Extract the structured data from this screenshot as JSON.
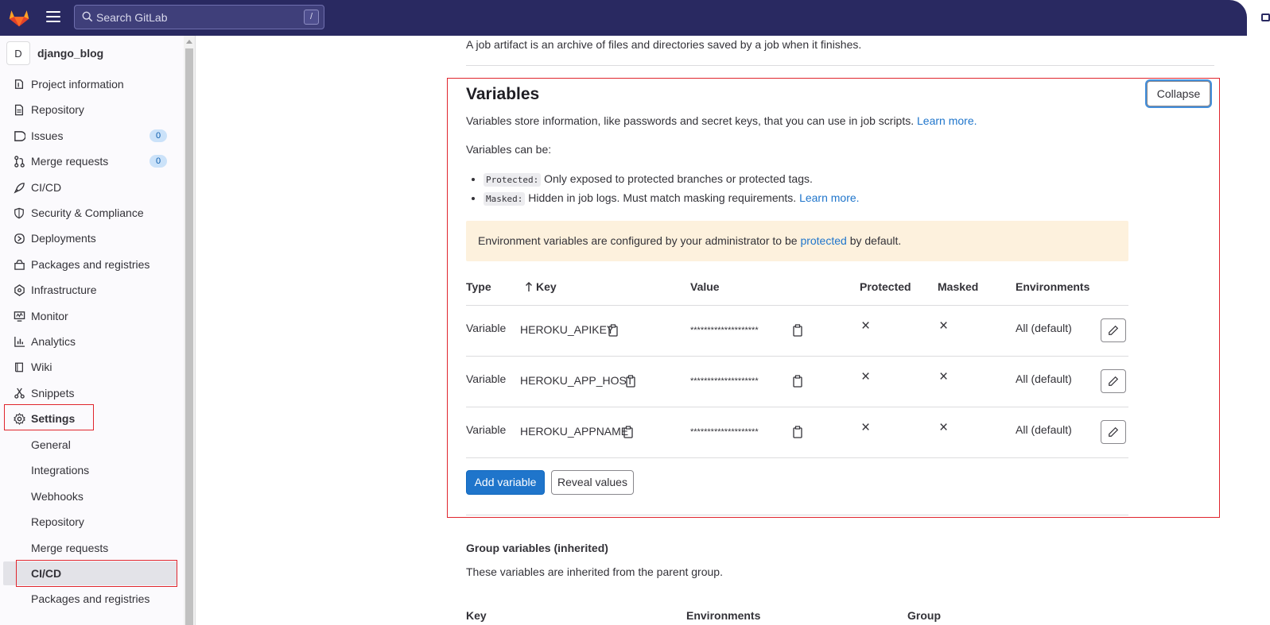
{
  "topbar": {
    "search_placeholder": "Search GitLab",
    "search_shortcut": "/",
    "colors": {
      "bg": "#292961",
      "logo": "#e24329"
    }
  },
  "sidebar": {
    "project_avatar": "D",
    "project_name": "django_blog",
    "items": [
      {
        "label": "Project information",
        "icon": "info-circle-icon"
      },
      {
        "label": "Repository",
        "icon": "document-icon"
      },
      {
        "label": "Issues",
        "icon": "issues-icon",
        "badge": "0"
      },
      {
        "label": "Merge requests",
        "icon": "merge-request-icon",
        "badge": "0"
      },
      {
        "label": "CI/CD",
        "icon": "rocket-icon"
      },
      {
        "label": "Security & Compliance",
        "icon": "shield-icon"
      },
      {
        "label": "Deployments",
        "icon": "deployments-icon"
      },
      {
        "label": "Packages and registries",
        "icon": "package-icon"
      },
      {
        "label": "Infrastructure",
        "icon": "cloud-gear-icon"
      },
      {
        "label": "Monitor",
        "icon": "monitor-icon"
      },
      {
        "label": "Analytics",
        "icon": "chart-icon"
      },
      {
        "label": "Wiki",
        "icon": "book-icon"
      },
      {
        "label": "Snippets",
        "icon": "snippet-icon"
      },
      {
        "label": "Settings",
        "icon": "gear-icon"
      }
    ],
    "settings_sub": [
      {
        "label": "General"
      },
      {
        "label": "Integrations"
      },
      {
        "label": "Webhooks"
      },
      {
        "label": "Repository"
      },
      {
        "label": "Merge requests"
      },
      {
        "label": "CI/CD",
        "active": true
      },
      {
        "label": "Packages and registries"
      }
    ]
  },
  "main": {
    "artifact_text": "A job artifact is an archive of files and directories saved by a job when it finishes.",
    "variables": {
      "title": "Variables",
      "collapse_label": "Collapse",
      "desc": "Variables store information, like passwords and secret keys, that you can use in job scripts.",
      "desc_link": "Learn more.",
      "can_be": "Variables can be:",
      "bullets": [
        {
          "code": "Protected:",
          "text": " Only exposed to protected branches or protected tags.",
          "link": ""
        },
        {
          "code": "Masked:",
          "text": " Hidden in job logs. Must match masking requirements. ",
          "link": "Learn more."
        }
      ],
      "alert": {
        "before": "Environment variables are configured by your administrator to be ",
        "link": "protected",
        "after": " by default."
      },
      "headers": {
        "type": "Type",
        "key": "Key",
        "value": "Value",
        "protected": "Protected",
        "masked": "Masked",
        "environments": "Environments"
      },
      "rows": [
        {
          "type": "Variable",
          "key": "HEROKU_APIKEY",
          "value": "********************",
          "protected": "×",
          "masked": "×",
          "env": "All (default)"
        },
        {
          "type": "Variable",
          "key": "HEROKU_APP_HOST",
          "value": "********************",
          "protected": "×",
          "masked": "×",
          "env": "All (default)"
        },
        {
          "type": "Variable",
          "key": "HEROKU_APPNAME",
          "value": "********************",
          "protected": "×",
          "masked": "×",
          "env": "All (default)"
        }
      ],
      "add_label": "Add variable",
      "reveal_label": "Reveal values"
    },
    "group": {
      "title": "Group variables (inherited)",
      "desc": "These variables are inherited from the parent group.",
      "headers": {
        "key": "Key",
        "environments": "Environments",
        "group": "Group"
      }
    }
  }
}
